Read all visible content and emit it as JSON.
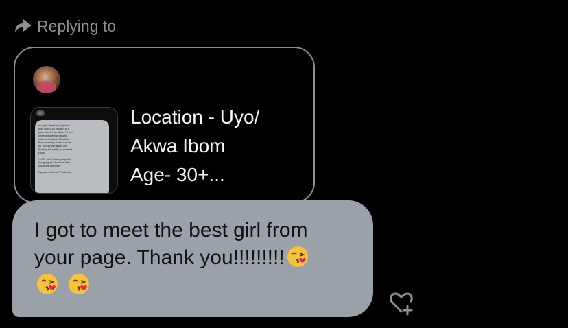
{
  "reply_header": {
    "label": "Replying to",
    "icon": "reply-arrow-icon"
  },
  "quoted_post": {
    "avatar_icon": "avatar",
    "thumbnail": {
      "header_badge": "19",
      "body_lines": [
        "I'm a girl, based in Uyo(Akwa",
        "Ibom State). An introvert to a",
        "great extent. I live alone. I'd love",
        "to interact with like minded,",
        "mature and discreet freaks in",
        "Akwa Ibom/Uyo. I'm bi-curious",
        "too, having your space and",
        "affording the basics for yourself",
        "is cool.",
        "",
        "I'm 30+, don't look my age tho.",
        "Younger guys who know their",
        "onions are welcome",
        "",
        "Guy can reach out. Thank you."
      ]
    },
    "text_lines": [
      "Location - Uyo/",
      "Akwa Ibom",
      "Age- 30+..."
    ]
  },
  "message": {
    "line1": "I got to meet the best girl from",
    "line2": "your page. Thank you!!!!!!!!!",
    "emoji_name": "face-blowing-a-kiss",
    "emoji_count": 3
  },
  "actions": {
    "react_icon": "heart-plus-icon"
  },
  "colors": {
    "background": "#000000",
    "bubble": "#9aa1a8",
    "muted_text": "#8b8f94",
    "card_border": "#8c8f93"
  }
}
